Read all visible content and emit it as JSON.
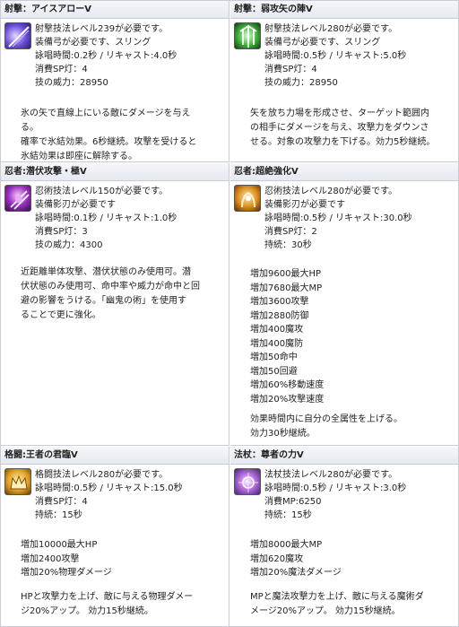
{
  "cells": [
    {
      "title": "射撃：アイスアローV",
      "icon": "ice-arrow-icon",
      "lines": [
        "射撃技法レベル239が必要です。",
        "装備弓が必要です、スリング",
        "詠唱時間:0.2秒 / リキャスト:4.0秒",
        "消費SP灯：4",
        "技の威力：28950"
      ],
      "desc": [
        "氷の矢で直線上にいる敵にダメージを与え",
        "る。",
        "確率で氷結効果。6秒継続。攻撃を受けると",
        "氷結効果は即座に解除する。"
      ]
    },
    {
      "title": "射撃：弱攻矢の陣V",
      "icon": "weak-arrow-formation-icon",
      "lines": [
        "射撃技法レベル280が必要です。",
        "装備弓が必要です、スリング",
        "詠唱時間:0.5秒 / リキャスト:5.0秒",
        "消費SP灯：4",
        "技の威力：28950"
      ],
      "desc": [
        "矢を放ち力場を形成させ、ターゲット範囲内",
        "の相手にダメージを与え、攻撃力をダウンさ",
        "せる。対象の攻撃力を下げる。効力5秒継続。"
      ]
    },
    {
      "title": "忍者:潜伏攻撃・極V",
      "icon": "stealth-attack-icon",
      "lines": [
        "忍術技法レベル150が必要です。",
        "装備影刃が必要です",
        "詠唱時間:0.1秒 / リキャスト:1.0秒",
        "消費SP灯：3",
        "技の威力：4300"
      ],
      "desc": [
        "近距離単体攻撃、潜伏状態のみ使用可。潜",
        "伏状態のみ使用可、命中率や威力が命中と回",
        "避の影響をうける。「幽鬼の術」を使用す",
        "ることで更に強化。"
      ]
    },
    {
      "title": "忍者:超絶強化V",
      "icon": "super-enhance-icon",
      "lines": [
        "忍術技法レベル280が必要です。",
        "装備影刃が必要です",
        "詠唱時間:0.5秒 / リキャスト:30.0秒",
        "消費SP灯：2",
        "持続：30秒"
      ],
      "buffs": [
        "増加9600最大HP",
        "増加7680最大MP",
        "増加3600攻撃",
        "増加2880防御",
        "増加400魔攻",
        "増加400魔防",
        "増加50命中",
        "増加50回避",
        "増加60%移動速度",
        "増加20%攻撃速度"
      ],
      "desc": [
        "効果時間内に自分の全属性を上げる。",
        "効力30秒継続。"
      ]
    },
    {
      "title": "格闘:王者の君臨V",
      "icon": "king-reign-icon",
      "lines": [
        "格闘技法レベル280が必要です。",
        "詠唱時間:0.5秒 / リキャスト:15.0秒",
        "消費SP灯：4",
        "持続：15秒"
      ],
      "buffs": [
        "増加10000最大HP",
        "増加2400攻撃",
        "増加20%物理ダメージ"
      ],
      "desc": [
        "HPと攻撃力を上げ、敵に与える物理ダメー",
        "ジ20%アップ。 効力15秒継続。"
      ]
    },
    {
      "title": "法杖：尊者の力V",
      "icon": "sage-power-icon",
      "lines": [
        "法杖技法レベル280が必要です。",
        "詠唱時間:0.5秒 / リキャスト:3.0秒",
        "消費MP:6250",
        "持続：15秒"
      ],
      "buffs": [
        "増加8000最大MP",
        "増加620魔攻",
        "増加20%魔法ダメージ"
      ],
      "desc": [
        "MPと魔法攻撃力を上げ、敵に与える魔術ダ",
        "メージ20%アップ。 効力15秒継続。"
      ]
    }
  ]
}
